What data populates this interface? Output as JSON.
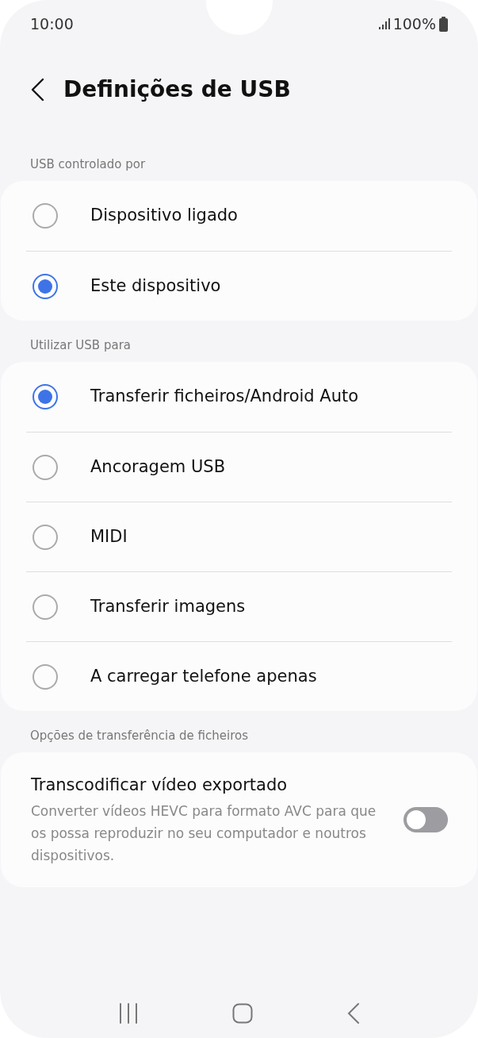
{
  "status_bar": {
    "time": "10:00",
    "battery": "100%"
  },
  "header": {
    "title": "Definições de USB"
  },
  "sections": [
    {
      "label": "USB controlado por",
      "items": [
        {
          "kind": "radio",
          "label": "Dispositivo ligado",
          "selected": false
        },
        {
          "kind": "radio",
          "label": "Este dispositivo",
          "selected": true
        }
      ]
    },
    {
      "label": "Utilizar USB para",
      "items": [
        {
          "kind": "radio",
          "label": "Transferir ficheiros/Android Auto",
          "selected": true
        },
        {
          "kind": "radio",
          "label": "Ancoragem USB",
          "selected": false
        },
        {
          "kind": "radio",
          "label": "MIDI",
          "selected": false
        },
        {
          "kind": "radio",
          "label": "Transferir imagens",
          "selected": false
        },
        {
          "kind": "radio",
          "label": "A carregar telefone apenas",
          "selected": false
        }
      ]
    },
    {
      "label": "Opções de transferência de ficheiros",
      "items": [
        {
          "kind": "switch",
          "title": "Transcodificar vídeo exportado",
          "description": "Converter vídeos HEVC para formato AVC para que os possa reproduzir no seu computador e noutros dispositivos.",
          "on": false
        }
      ]
    }
  ]
}
